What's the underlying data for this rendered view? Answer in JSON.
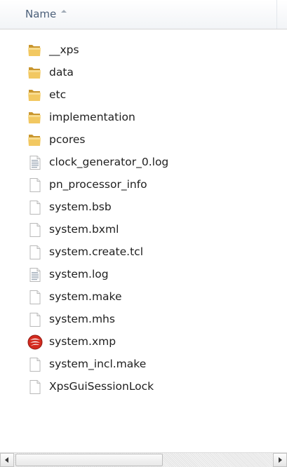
{
  "header": {
    "name_column_label": "Name",
    "sort_direction": "ascending"
  },
  "files": [
    {
      "name": "__xps",
      "icon": "folder-icon"
    },
    {
      "name": "data",
      "icon": "folder-icon"
    },
    {
      "name": "etc",
      "icon": "folder-icon"
    },
    {
      "name": "implementation",
      "icon": "folder-icon"
    },
    {
      "name": "pcores",
      "icon": "folder-icon"
    },
    {
      "name": "clock_generator_0.log",
      "icon": "text-file-icon"
    },
    {
      "name": "pn_processor_info",
      "icon": "blank-file-icon"
    },
    {
      "name": "system.bsb",
      "icon": "blank-file-icon"
    },
    {
      "name": "system.bxml",
      "icon": "blank-file-icon"
    },
    {
      "name": "system.create.tcl",
      "icon": "blank-file-icon"
    },
    {
      "name": "system.log",
      "icon": "text-file-icon"
    },
    {
      "name": "system.make",
      "icon": "blank-file-icon"
    },
    {
      "name": "system.mhs",
      "icon": "blank-file-icon"
    },
    {
      "name": "system.xmp",
      "icon": "xps-project-icon"
    },
    {
      "name": "system_incl.make",
      "icon": "blank-file-icon"
    },
    {
      "name": "XpsGuiSessionLock",
      "icon": "blank-file-icon"
    }
  ],
  "colors": {
    "folder": "#e8b84a",
    "text": "#1e1e1e",
    "header_text": "#4c607a",
    "xps_red": "#d42a1e"
  }
}
